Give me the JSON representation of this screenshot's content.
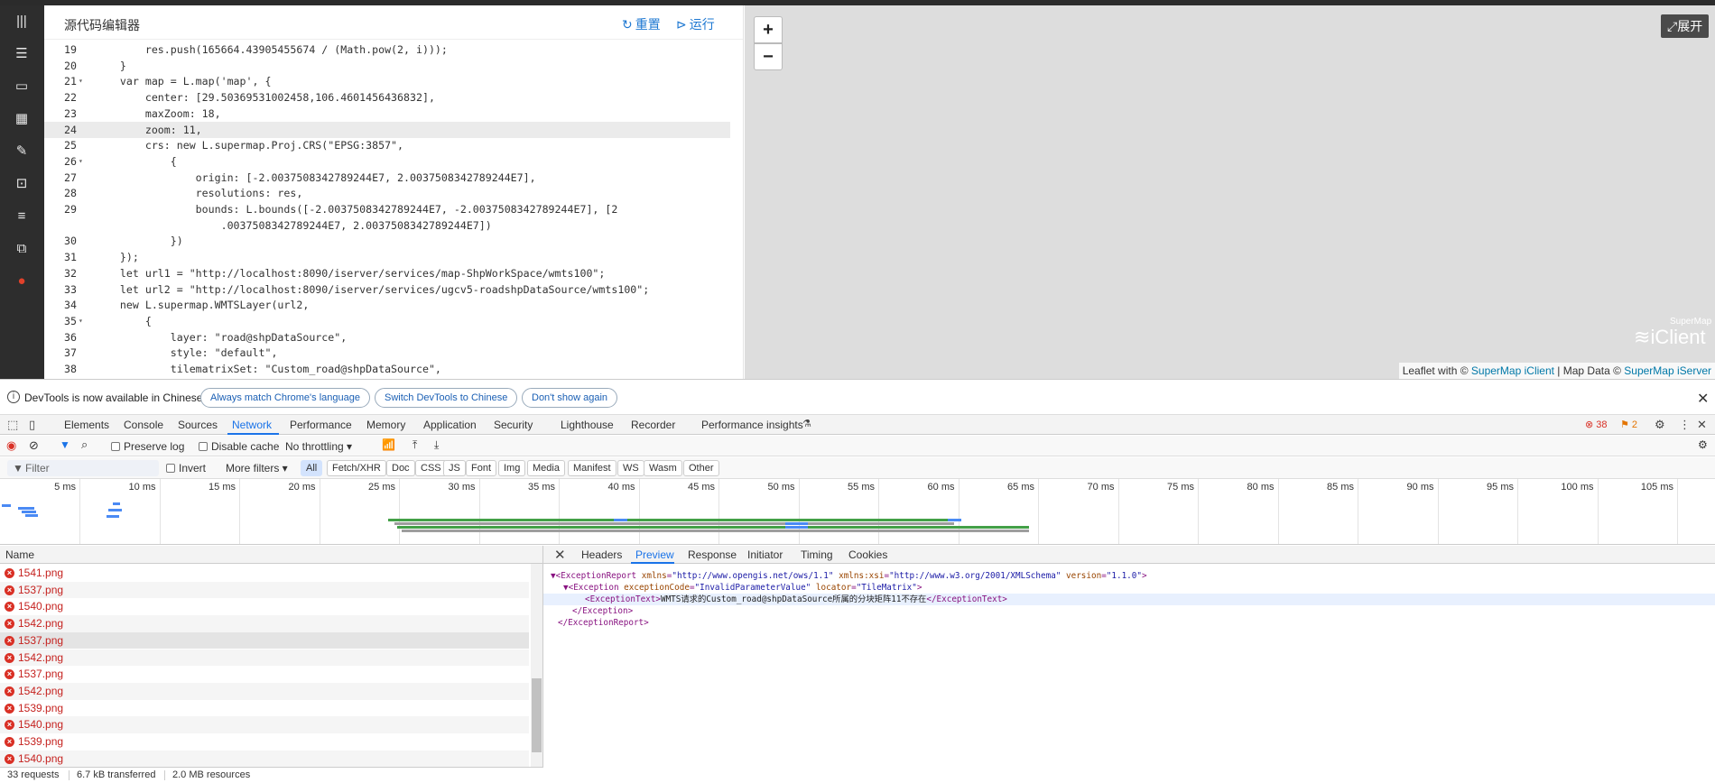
{
  "editor": {
    "title": "源代码编辑器",
    "reset_label": "重置",
    "run_label": "运行",
    "lines": [
      {
        "num": "19",
        "fold": "",
        "text": "        res.push(165664.43905455674 / (Math.pow(2, i)));",
        "active": false
      },
      {
        "num": "20",
        "fold": "",
        "text": "    }",
        "active": false
      },
      {
        "num": "21",
        "fold": "▾",
        "text": "    var map = L.map('map', {",
        "active": false
      },
      {
        "num": "22",
        "fold": "",
        "text": "        center: [29.50369531002458,106.4601456436832],",
        "active": false
      },
      {
        "num": "23",
        "fold": "",
        "text": "        maxZoom: 18,",
        "active": false
      },
      {
        "num": "24",
        "fold": "",
        "text": "        zoom: 11,",
        "active": true
      },
      {
        "num": "25",
        "fold": "",
        "text": "        crs: new L.supermap.Proj.CRS(\"EPSG:3857\",",
        "active": false
      },
      {
        "num": "26",
        "fold": "▾",
        "text": "            {",
        "active": false
      },
      {
        "num": "27",
        "fold": "",
        "text": "                origin: [-2.0037508342789244E7, 2.0037508342789244E7],",
        "active": false
      },
      {
        "num": "28",
        "fold": "",
        "text": "                resolutions: res,",
        "active": false
      },
      {
        "num": "29",
        "fold": "",
        "text": "                bounds: L.bounds([-2.0037508342789244E7, -2.0037508342789244E7], [2",
        "active": false
      },
      {
        "num": "",
        "fold": "",
        "text": "                    .0037508342789244E7, 2.0037508342789244E7])",
        "active": false
      },
      {
        "num": "30",
        "fold": "",
        "text": "            })",
        "active": false
      },
      {
        "num": "31",
        "fold": "",
        "text": "    });",
        "active": false
      },
      {
        "num": "32",
        "fold": "",
        "text": "    let url1 = \"http://localhost:8090/iserver/services/map-ShpWorkSpace/wmts100\";",
        "active": false
      },
      {
        "num": "33",
        "fold": "",
        "text": "    let url2 = \"http://localhost:8090/iserver/services/ugcv5-roadshpDataSource/wmts100\";",
        "active": false
      },
      {
        "num": "34",
        "fold": "",
        "text": "    new L.supermap.WMTSLayer(url2,",
        "active": false
      },
      {
        "num": "35",
        "fold": "▾",
        "text": "        {",
        "active": false
      },
      {
        "num": "36",
        "fold": "",
        "text": "            layer: \"road@shpDataSource\",",
        "active": false
      },
      {
        "num": "37",
        "fold": "",
        "text": "            style: \"default\",",
        "active": false
      },
      {
        "num": "38",
        "fold": "",
        "text": "            tilematrixSet: \"Custom_road@shpDataSource\",",
        "active": false
      }
    ]
  },
  "map": {
    "zoom_in": "+",
    "zoom_out": "−",
    "expand_label": "展开",
    "logo_small": "SuperMap",
    "logo_big": "iClient",
    "attr_prefix": "Leaflet with © ",
    "attr_link1": "SuperMap iClient",
    "attr_mid": " | Map Data © ",
    "attr_link2": "SuperMap iServer"
  },
  "banner": {
    "text": "DevTools is now available in Chinese!",
    "btn1": "Always match Chrome's language",
    "btn2": "Switch DevTools to Chinese",
    "btn3": "Don't show again",
    "close": "✕"
  },
  "devtools": {
    "tabs": [
      "Elements",
      "Console",
      "Sources",
      "Network",
      "Performance",
      "Memory",
      "Application",
      "Security",
      "Lighthouse",
      "Recorder",
      "Performance insights"
    ],
    "active_tab": "Network",
    "error_count": "38",
    "warning_count": "2"
  },
  "network_toolbar": {
    "preserve_log": "Preserve log",
    "disable_cache": "Disable cache",
    "throttling": "No throttling"
  },
  "filter": {
    "placeholder": "Filter",
    "invert": "Invert",
    "more_filters": "More filters",
    "chips": [
      "All",
      "Fetch/XHR",
      "Doc",
      "CSS",
      "JS",
      "Font",
      "Img",
      "Media",
      "Manifest",
      "WS",
      "Wasm",
      "Other"
    ]
  },
  "timeline": {
    "ticks": [
      "5 ms",
      "10 ms",
      "15 ms",
      "20 ms",
      "25 ms",
      "30 ms",
      "35 ms",
      "40 ms",
      "45 ms",
      "50 ms",
      "55 ms",
      "60 ms",
      "65 ms",
      "70 ms",
      "75 ms",
      "80 ms",
      "85 ms",
      "90 ms",
      "95 ms",
      "100 ms",
      "105 ms"
    ]
  },
  "requests": {
    "header": "Name",
    "rows": [
      "1541.png",
      "1537.png",
      "1540.png",
      "1542.png",
      "1537.png",
      "1542.png",
      "1537.png",
      "1542.png",
      "1539.png",
      "1540.png",
      "1539.png",
      "1540.png"
    ]
  },
  "details": {
    "tabs": [
      "Headers",
      "Preview",
      "Response",
      "Initiator",
      "Timing",
      "Cookies"
    ],
    "active_tab": "Preview",
    "xml": {
      "l1_open": "▼<ExceptionReport ",
      "l1_a1": "xmlns",
      "l1_v1": "\"http://www.opengis.net/ows/1.1\"",
      "l1_a2": "xmlns:xsi",
      "l1_v2": "\"http://www.w3.org/2001/XMLSchema\"",
      "l1_a3": "version",
      "l1_v3": "\"1.1.0\"",
      "l2_open": "▼<Exception ",
      "l2_a1": "exceptionCode",
      "l2_v1": "\"InvalidParameterValue\"",
      "l2_a2": "locator",
      "l2_v2": "\"TileMatrix\"",
      "l3_tag_open": "<ExceptionText>",
      "l3_text": "WMTS请求的Custom_road@shpDataSource所属的分块矩阵11不存在",
      "l3_tag_close": "</ExceptionText>",
      "l4": "</Exception>",
      "l5": "</ExceptionReport>"
    }
  },
  "status": {
    "requests": "33 requests",
    "transferred": "6.7 kB transferred",
    "resources": "2.0 MB resources"
  }
}
